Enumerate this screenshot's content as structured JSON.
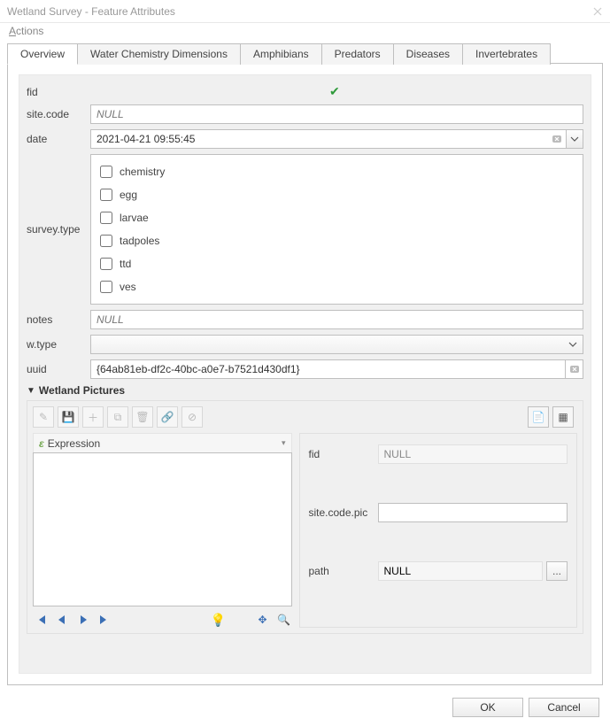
{
  "window": {
    "title": "Wetland Survey - Feature Attributes"
  },
  "menu": {
    "actions_label": "Actions"
  },
  "tabs": [
    "Overview",
    "Water Chemistry Dimensions",
    "Amphibians",
    "Predators",
    "Diseases",
    "Invertebrates"
  ],
  "fields": {
    "fid_label": "fid",
    "sitecode_label": "site.code",
    "sitecode_value": "NULL",
    "date_label": "date",
    "date_value": "2021-04-21 09:55:45",
    "surveytype_label": "survey.type",
    "surveytype_options": [
      "chemistry",
      "egg",
      "larvae",
      "tadpoles",
      "ttd",
      "ves"
    ],
    "notes_label": "notes",
    "notes_placeholder": "NULL",
    "wtype_label": "w.type",
    "uuid_label": "uuid",
    "uuid_value": "{64ab81eb-df2c-40bc-a0e7-b7521d430df1}"
  },
  "pictures": {
    "section_title": "Wetland Pictures",
    "expression_label": "Expression",
    "fid_label": "fid",
    "fid_value": "NULL",
    "sitecode_label": "site.code.pic",
    "sitecode_value": "",
    "path_label": "path",
    "path_value": "NULL",
    "path_btn": "..."
  },
  "footer": {
    "ok": "OK",
    "cancel": "Cancel"
  }
}
